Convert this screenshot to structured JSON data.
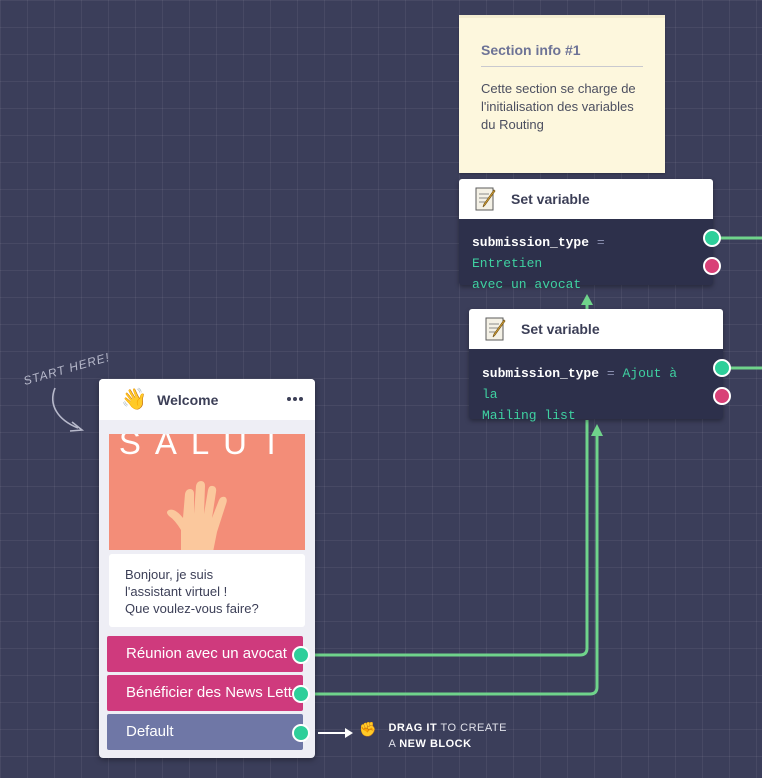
{
  "note": {
    "title": "Section info #1",
    "body": "Cette section se charge de l'initialisation des variables du Routing"
  },
  "blocks": [
    {
      "title": "Set variable",
      "variable": "submission_type",
      "operator": "=",
      "value_line1": "Entretien",
      "value_line2": "avec un avocat"
    },
    {
      "title": "Set variable",
      "variable": "submission_type",
      "operator": "=",
      "value_line1": "Ajout à la",
      "value_line2": "Mailing list"
    }
  ],
  "welcome": {
    "title": "Welcome",
    "image_text": "SALUT",
    "message_line1": "Bonjour, je suis",
    "message_line2": "l'assistant virtuel !",
    "message_line3": "Que voulez-vous faire?",
    "choices": [
      "Réunion avec un avocat",
      "Bénéficier des News Letter",
      "Default"
    ]
  },
  "hints": {
    "start_here": "START HERE!",
    "drag_bold": "DRAG IT",
    "drag_rest": " TO CREATE",
    "drag_line2_pre": "A ",
    "drag_line2_bold": "NEW BLOCK"
  },
  "colors": {
    "background": "#3b3e5a",
    "connector": "#6fd38b",
    "choice_pink": "#cf3a7d",
    "choice_grey": "#6f77a6",
    "port_green": "#2ecf9a",
    "port_red": "#d94077",
    "value_text": "#3fd1a1"
  }
}
